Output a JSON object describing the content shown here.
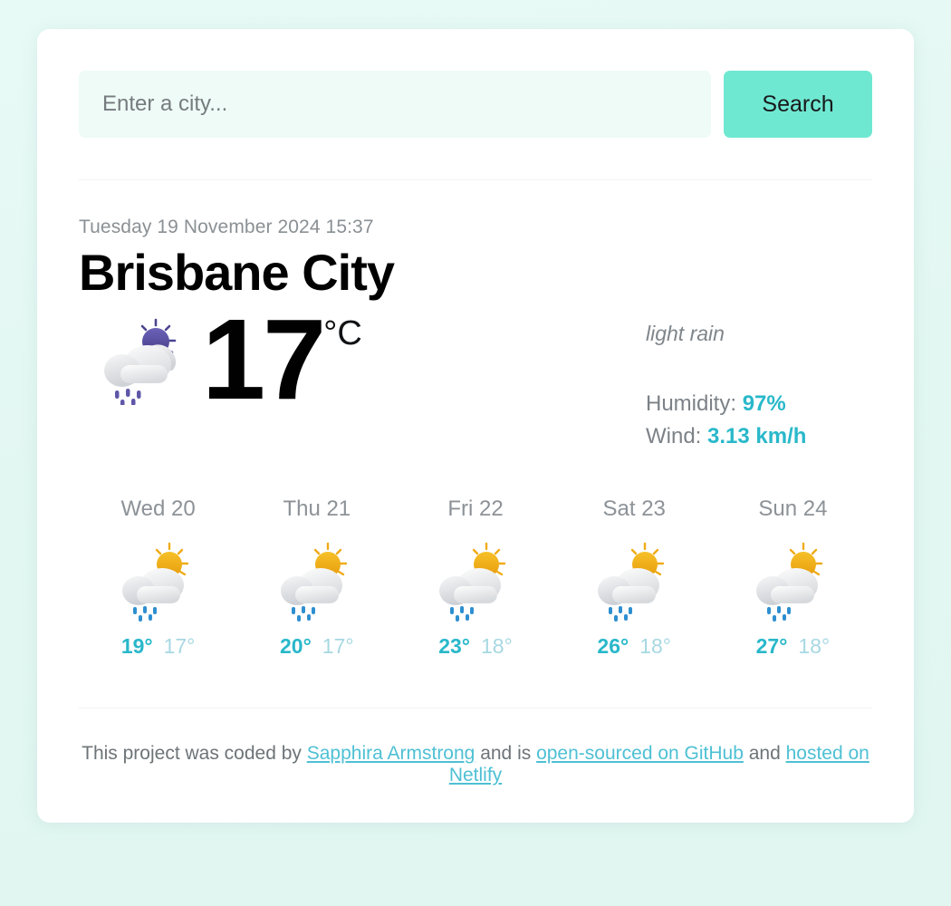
{
  "search": {
    "placeholder": "Enter a city...",
    "value": "",
    "button_label": "Search"
  },
  "current": {
    "date": "Tuesday 19 November 2024 15:37",
    "city": "Brisbane City",
    "temperature": "17",
    "unit": "°C",
    "condition": "light rain",
    "icon": "cloud-sun-rain-icon",
    "humidity_label": "Humidity:",
    "humidity_value": "97%",
    "wind_label": "Wind:",
    "wind_value": "3.13 km/h"
  },
  "forecast": [
    {
      "day": "Wed 20",
      "icon": "cloud-sun-rain-icon",
      "max": "19°",
      "min": "17°"
    },
    {
      "day": "Thu 21",
      "icon": "cloud-sun-rain-icon",
      "max": "20°",
      "min": "17°"
    },
    {
      "day": "Fri 22",
      "icon": "cloud-sun-rain-icon",
      "max": "23°",
      "min": "18°"
    },
    {
      "day": "Sat 23",
      "icon": "cloud-sun-rain-icon",
      "max": "26°",
      "min": "18°"
    },
    {
      "day": "Sun 24",
      "icon": "cloud-sun-rain-icon",
      "max": "27°",
      "min": "18°"
    }
  ],
  "footer": {
    "text_1": "This project was coded by ",
    "link_author": "Sapphira Armstrong",
    "text_2": " and is ",
    "link_source": "open-sourced on GitHub",
    "text_3": " and ",
    "link_host": "hosted on Netlify"
  },
  "colors": {
    "accent_teal": "#29b8ca",
    "button_mint": "#6fe8d2",
    "input_fill": "#eefbf7",
    "page_bg": "#e3f7f2",
    "sun_yellow": "#f0ab18",
    "sun_purple": "#4b4490",
    "rain_blue": "#2e8fd0"
  }
}
